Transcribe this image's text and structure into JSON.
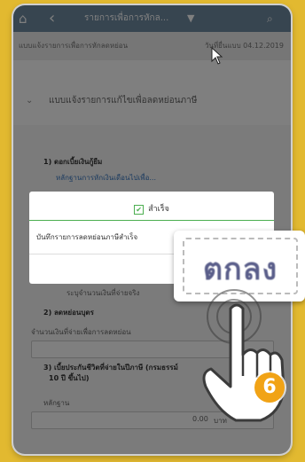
{
  "nav": {
    "title": "รายการเพื่อการหักล...",
    "back_icon": "chevron-left-icon",
    "home_icon": "home-icon",
    "dropdown_icon": "chevron-down-icon",
    "search_icon": "search-icon"
  },
  "subheader": {
    "left": "แบบแจ้งรายการเพื่อการหักลดหย่อน",
    "right": "วันที่ยื่นแบบ 04.12.2019"
  },
  "section": {
    "title": "แบบแจ้งรายการแก้ไขเพื่อลดหย่อนภาษี"
  },
  "form": {
    "q1": "1) ดอกเบี้ยเงินกู้ยืม",
    "q1_sub": "หลักฐานการหักเงินเดือนไปเพื่อ...",
    "q1_value": "ระบุจำนวนเงินที่จ่ายจริง",
    "q2": "2) ลดหย่อนบุตร",
    "q2_sub": "จำนวนเงินที่จ่ายเพื่อการลดหย่อน",
    "q3": "3) เบี้ยประกันชีวิตที่จ่ายในปีภาษี (กรมธรรม์",
    "q3b": "10 ปี ขึ้นไป)",
    "q3_label": "หลักฐาน",
    "q3_amount": "0.00",
    "q3_unit": "บาท"
  },
  "dialog": {
    "title": "สำเร็จ",
    "message": "บันทึกรายการลดหย่อนภาษีสำเร็จ"
  },
  "zoom": {
    "label": "ตกลง"
  },
  "step": {
    "number": "6"
  },
  "colors": {
    "background": "#e2b930",
    "topbar": "#6f8aa0",
    "success": "#4caf50",
    "badge": "#f1a316"
  }
}
